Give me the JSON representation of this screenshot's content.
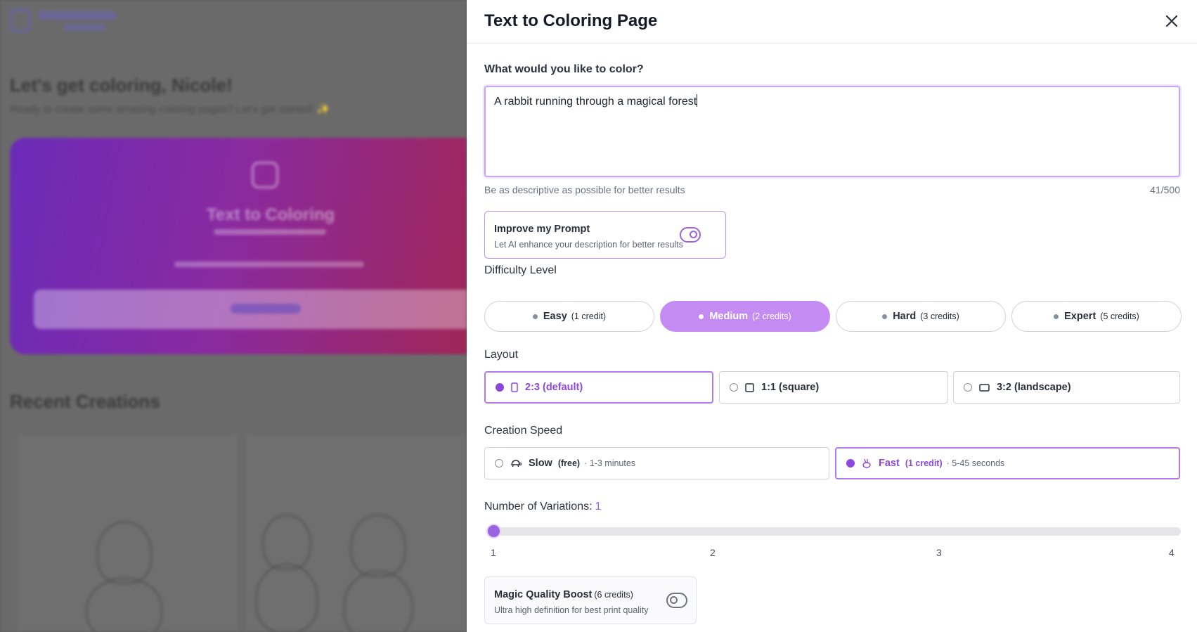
{
  "background": {
    "greeting": "Let's get coloring, Nicole!",
    "subtitle": "Ready to create some amazing coloring pages? Let's get started! ✨",
    "hero_title": "Text to Coloring",
    "recent_title": "Recent Creations"
  },
  "modal": {
    "title": "Text to Coloring Page",
    "prompt_label": "What would you like to color?",
    "prompt_value": "A rabbit running through a magical forest",
    "prompt_hint": "Be as descriptive as possible for better results",
    "char_count": "41/500",
    "improve": {
      "title": "Improve my Prompt",
      "description": "Let AI enhance your description for better results",
      "enabled": true
    },
    "difficulty": {
      "label": "Difficulty Level",
      "options": [
        {
          "label": "Easy",
          "credits": "(1 credit)",
          "selected": false
        },
        {
          "label": "Medium",
          "credits": "(2 credits)",
          "selected": true
        },
        {
          "label": "Hard",
          "credits": "(3 credits)",
          "selected": false
        },
        {
          "label": "Expert",
          "credits": "(5 credits)",
          "selected": false
        }
      ]
    },
    "layout": {
      "label": "Layout",
      "options": [
        {
          "label": "2:3 (default)",
          "icon": "portrait-rect-icon",
          "selected": true
        },
        {
          "label": "1:1 (square)",
          "icon": "square-icon",
          "selected": false
        },
        {
          "label": "3:2 (landscape)",
          "icon": "landscape-rect-icon",
          "selected": false
        }
      ]
    },
    "speed": {
      "label": "Creation Speed",
      "options": [
        {
          "label": "Slow",
          "credits": "(free)",
          "time": "· 1-3 minutes",
          "icon": "turtle-icon",
          "selected": false
        },
        {
          "label": "Fast",
          "credits": "(1 credit)",
          "time": "· 5-45 seconds",
          "icon": "rabbit-icon",
          "selected": true
        }
      ]
    },
    "variations": {
      "label": "Number of Variations:",
      "value": "1",
      "ticks": [
        "1",
        "2",
        "3",
        "4"
      ]
    },
    "boost": {
      "title": "Magic Quality Boost",
      "credits": "(6 credits)",
      "description": "Ultra high definition for best print quality",
      "enabled": false
    },
    "colors": {
      "accent": "#9a63e0",
      "accent_light": "#c48cf2",
      "accent_text": "#8c47dc"
    }
  }
}
